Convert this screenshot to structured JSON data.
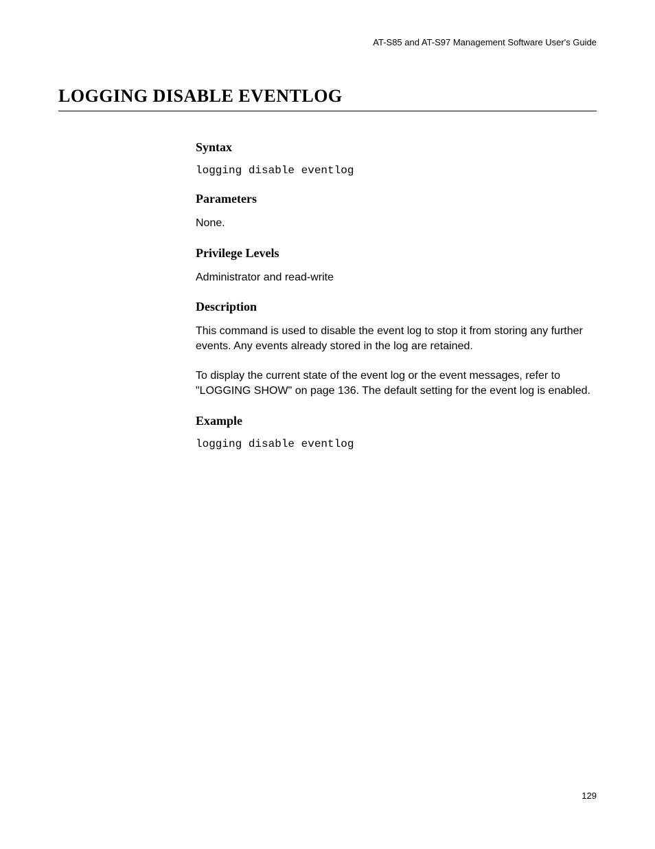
{
  "header": {
    "running_title": "AT-S85 and AT-S97 Management Software User's Guide"
  },
  "title": "LOGGING DISABLE EVENTLOG",
  "sections": {
    "syntax": {
      "heading": "Syntax",
      "code": "logging disable eventlog"
    },
    "parameters": {
      "heading": "Parameters",
      "text": "None."
    },
    "privilege": {
      "heading": "Privilege Levels",
      "text": "Administrator and read-write"
    },
    "description": {
      "heading": "Description",
      "para1": "This command is used to disable the event log to stop it from storing any further events. Any events already stored in the log are retained.",
      "para2": "To display the current state of the event log or the event messages, refer to \"LOGGING SHOW\" on page 136. The default setting for the event log is enabled."
    },
    "example": {
      "heading": "Example",
      "code": "logging disable eventlog"
    }
  },
  "page_number": "129"
}
